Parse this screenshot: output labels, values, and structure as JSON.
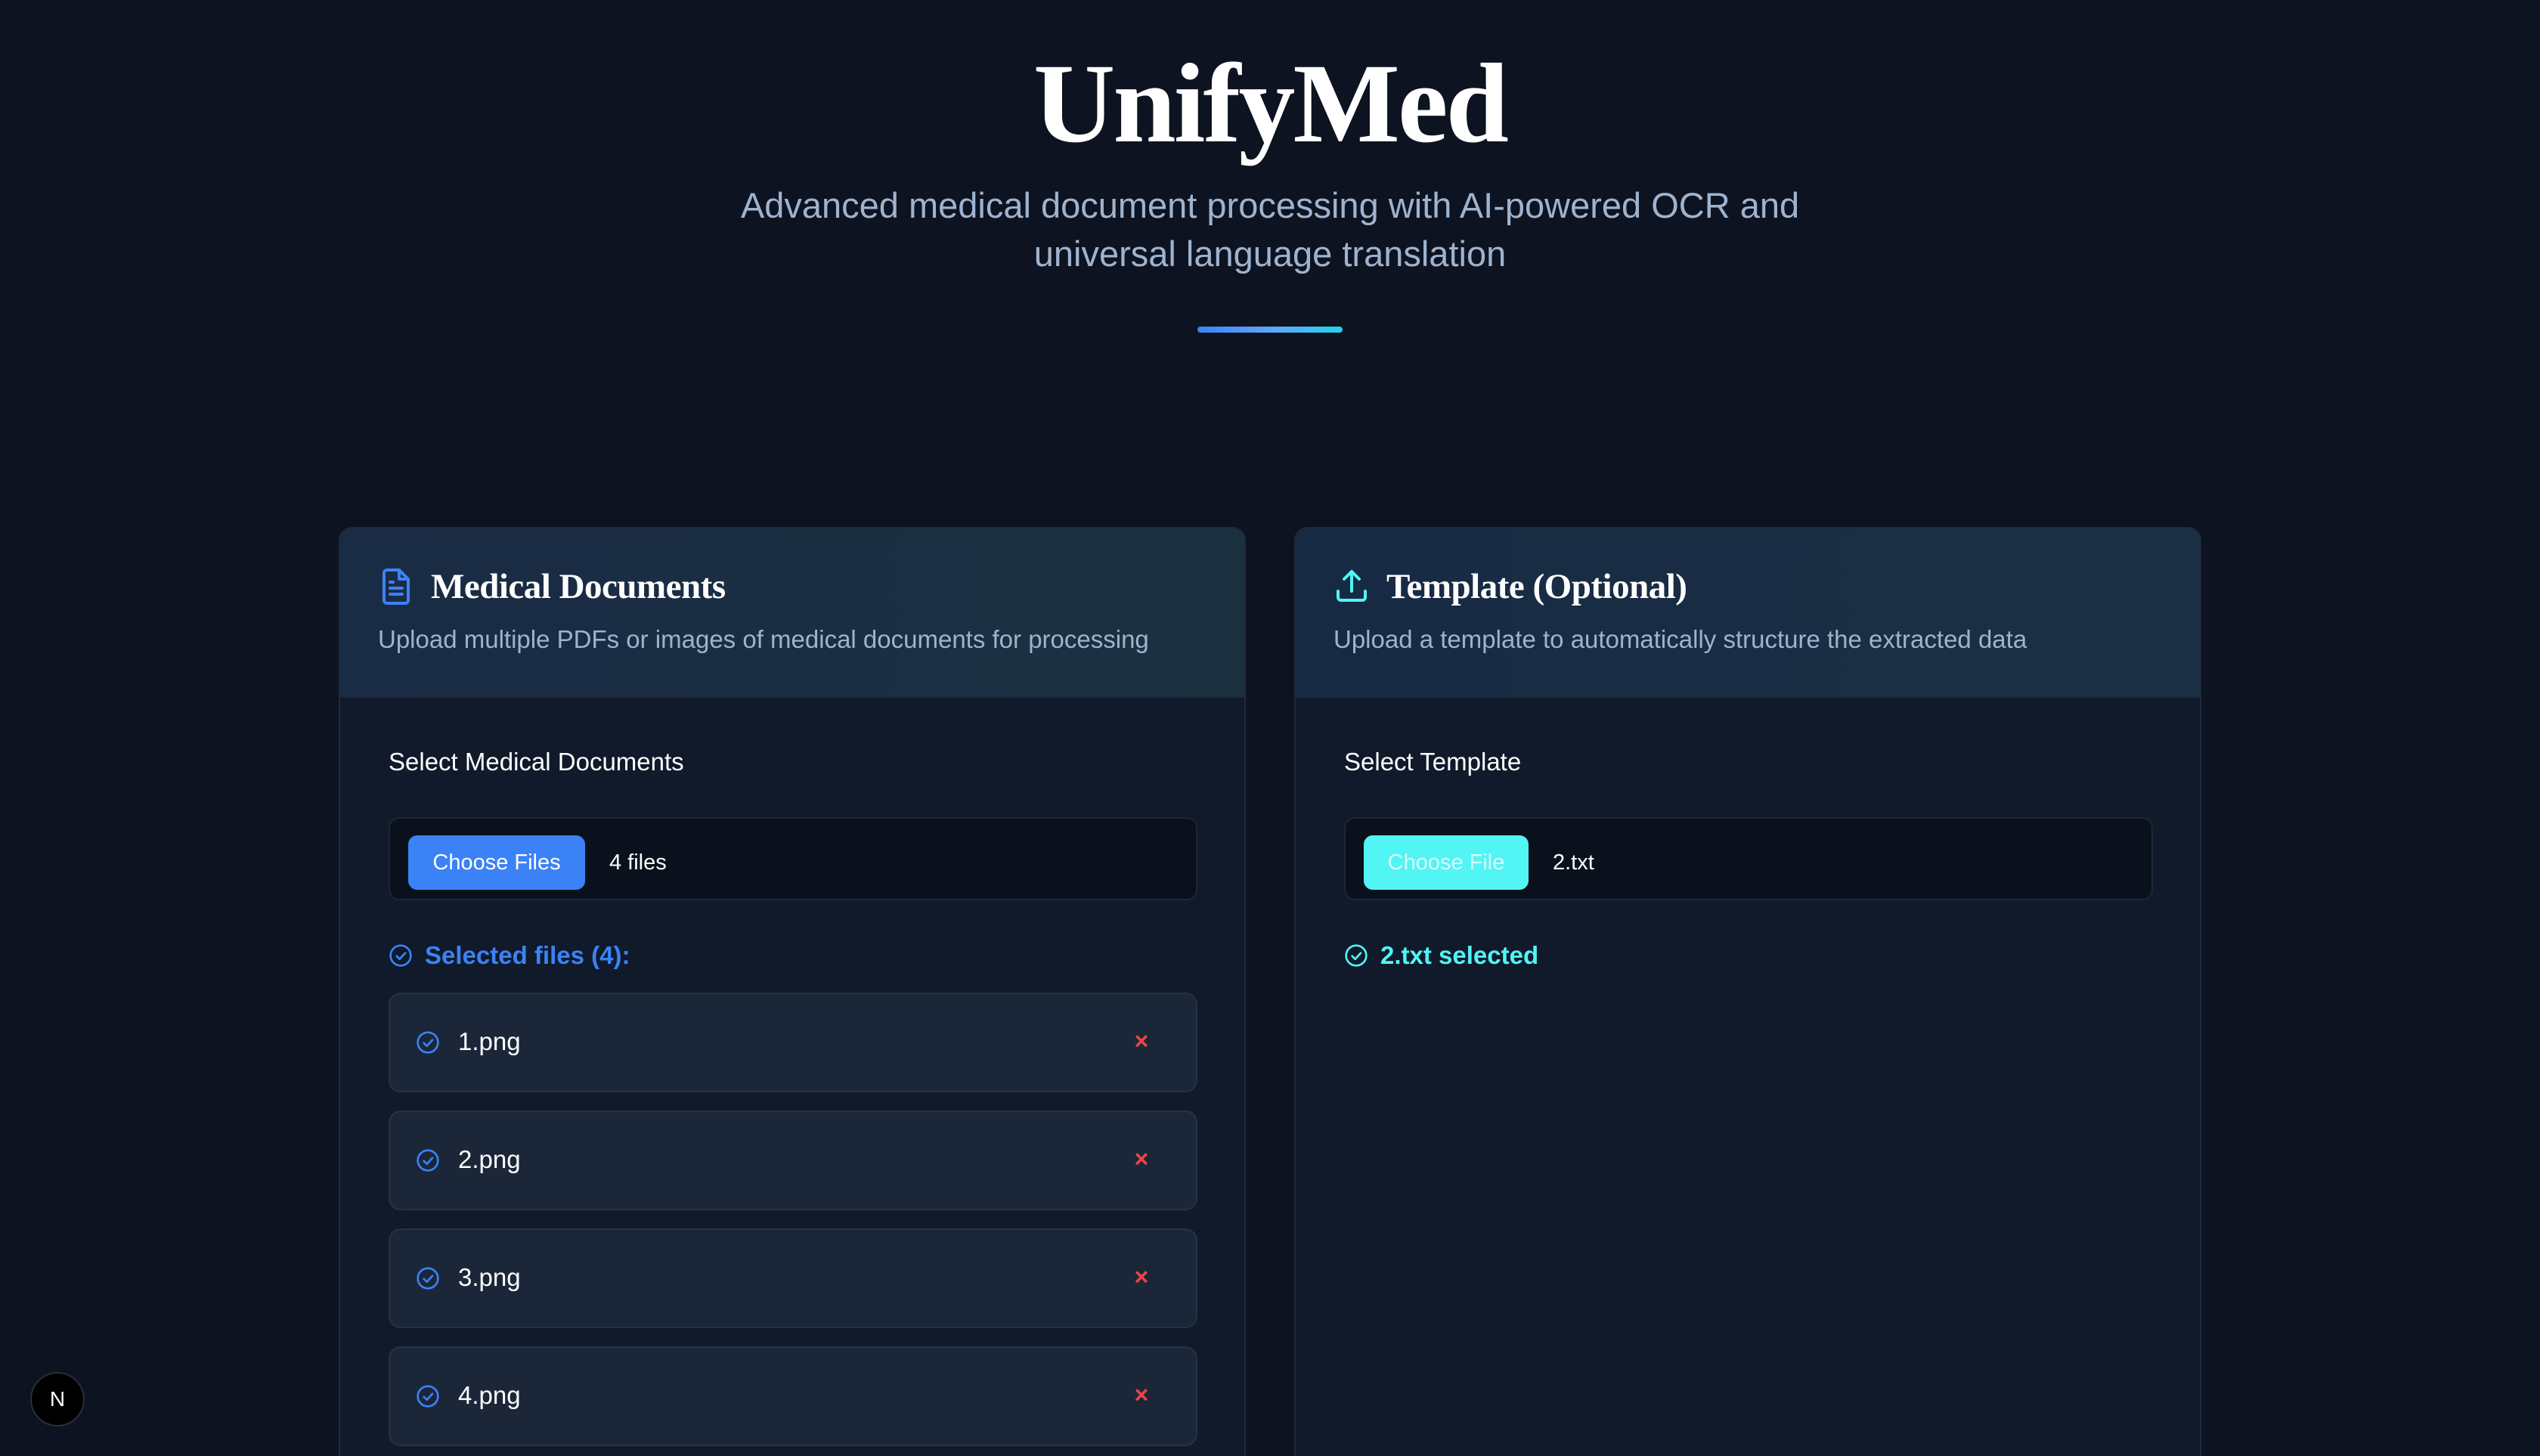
{
  "hero": {
    "title": "UnifyMed",
    "subtitle_line1": "Advanced medical document processing with AI-powered OCR and",
    "subtitle_line2": "universal language translation"
  },
  "documents_card": {
    "icon": "file-text-icon",
    "title": "Medical Documents",
    "description": "Upload multiple PDFs or images of medical documents for processing",
    "field_label": "Select Medical Documents",
    "button_label": "Choose Files",
    "file_count": "4 files",
    "selected_heading": "Selected files (4):",
    "files": [
      {
        "name": "1.png",
        "remove": "×"
      },
      {
        "name": "2.png",
        "remove": "×"
      },
      {
        "name": "3.png",
        "remove": "×"
      },
      {
        "name": "4.png",
        "remove": "×"
      }
    ],
    "accent": "#3b82f6"
  },
  "template_card": {
    "icon": "upload-icon",
    "title": "Template (Optional)",
    "description": "Upload a template to automatically structure the extracted data",
    "field_label": "Select Template",
    "button_label": "Choose File",
    "file_name": "2.txt",
    "selected_text": "2.txt selected",
    "accent": "#52f4f4"
  },
  "dev_badge": {
    "icon": "nextjs-logo-icon",
    "letter": "N"
  }
}
